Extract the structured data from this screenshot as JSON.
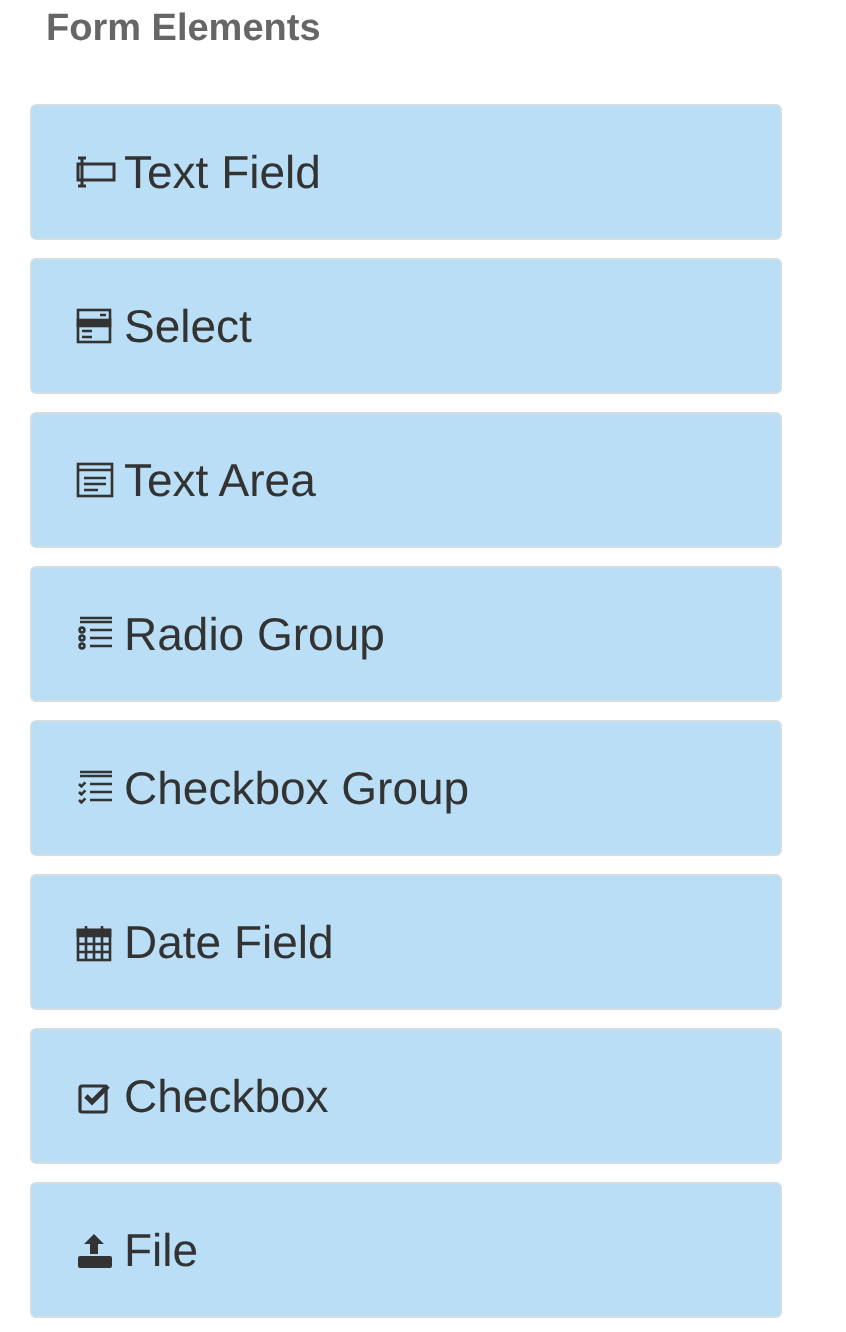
{
  "title": "Form Elements",
  "items": [
    {
      "kind": "text-field",
      "label": "Text Field"
    },
    {
      "kind": "select",
      "label": "Select"
    },
    {
      "kind": "text-area",
      "label": "Text Area"
    },
    {
      "kind": "radio-group",
      "label": "Radio Group"
    },
    {
      "kind": "checkbox-group",
      "label": "Checkbox Group"
    },
    {
      "kind": "date-field",
      "label": "Date Field"
    },
    {
      "kind": "checkbox",
      "label": "Checkbox"
    },
    {
      "kind": "file",
      "label": "File"
    }
  ]
}
